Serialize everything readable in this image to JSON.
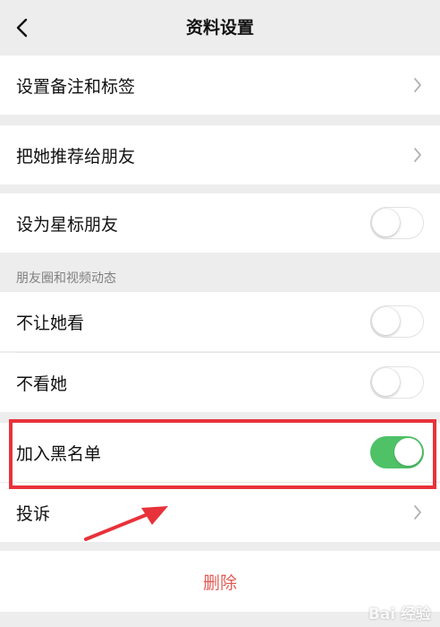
{
  "header": {
    "title": "资料设置",
    "back_icon": "chevron-left-icon"
  },
  "items": {
    "set_remark": {
      "label": "设置备注和标签"
    },
    "recommend": {
      "label": "把她推荐给朋友"
    },
    "star_friend": {
      "label": "设为星标朋友",
      "toggle_on": false
    }
  },
  "moments_section": {
    "title": "朋友圈和视频动态",
    "hide_from_her": {
      "label": "不让她看",
      "toggle_on": false
    },
    "hide_her": {
      "label": "不看她",
      "toggle_on": false
    }
  },
  "blacklist": {
    "label": "加入黑名单",
    "toggle_on": true
  },
  "report": {
    "label": "投诉"
  },
  "delete": {
    "label": "删除"
  },
  "annotation": {
    "highlight_color": "#e8323a"
  },
  "colors": {
    "toggle_on": "#4fc167",
    "delete_text": "#e25c55",
    "background": "#ededed"
  },
  "watermark": {
    "text": "Bai 经验"
  }
}
